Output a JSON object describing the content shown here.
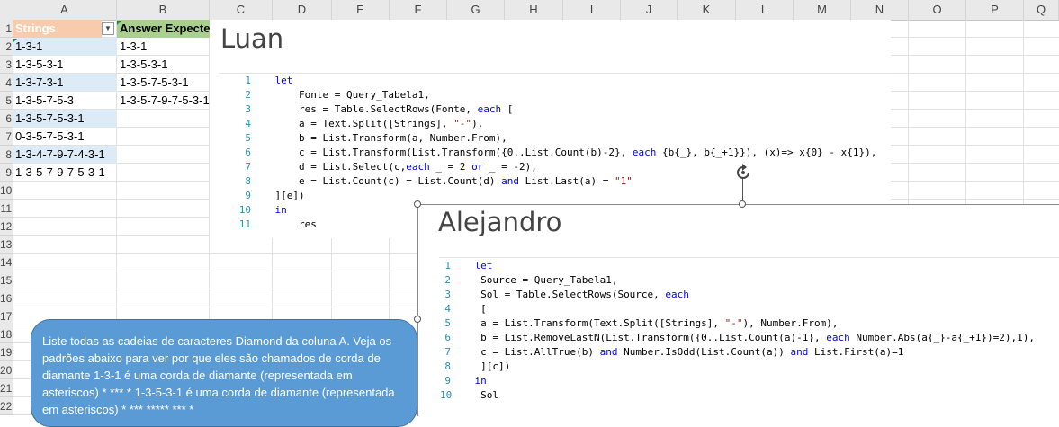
{
  "spreadsheet": {
    "columns": [
      "A",
      "B",
      "C",
      "D",
      "E",
      "F",
      "G",
      "H",
      "I",
      "J",
      "K",
      "L",
      "M",
      "N",
      "O",
      "P",
      "Q"
    ],
    "rows": [
      "1",
      "2",
      "3",
      "4",
      "5",
      "6",
      "7",
      "8",
      "9",
      "10",
      "11",
      "12",
      "13",
      "14",
      "15",
      "16",
      "17",
      "18",
      "19",
      "20",
      "21",
      "22"
    ],
    "header_a": "Strings",
    "header_b": "Answer Expected",
    "strings": [
      "1-3-1",
      "1-3-5-3-1",
      "1-3-7-3-1",
      "1-3-5-7-5-3",
      "1-3-5-7-5-3-1",
      "0-3-5-7-5-3-1",
      "1-3-4-7-9-7-4-3-1",
      "1-3-5-7-9-7-5-3-1"
    ],
    "expected": [
      "1-3-1",
      "1-3-5-3-1",
      "1-3-5-7-5-3-1",
      "1-3-5-7-9-7-5-3-1"
    ],
    "filter_icon": "dropdown-arrow-icon"
  },
  "luan": {
    "title": "Luan",
    "lines": [
      {
        "num": "1",
        "parts": [
          {
            "t": "kw",
            "v": "let"
          }
        ]
      },
      {
        "num": "2",
        "parts": [
          {
            "t": "n",
            "v": "    Fonte = Query_Tabela1,"
          }
        ]
      },
      {
        "num": "3",
        "parts": [
          {
            "t": "n",
            "v": "    res = Table.SelectRows(Fonte, "
          },
          {
            "t": "kw",
            "v": "each"
          },
          {
            "t": "n",
            "v": " ["
          }
        ]
      },
      {
        "num": "4",
        "parts": [
          {
            "t": "n",
            "v": "    a = Text.Split([Strings], "
          },
          {
            "t": "str",
            "v": "\"-\""
          },
          {
            "t": "n",
            "v": "),"
          }
        ]
      },
      {
        "num": "5",
        "parts": [
          {
            "t": "n",
            "v": "    b = List.Transform(a, Number.From),"
          }
        ]
      },
      {
        "num": "6",
        "parts": [
          {
            "t": "n",
            "v": "    c = List.Transform(List.Transform({0..List.Count(b)-2}, "
          },
          {
            "t": "kw",
            "v": "each"
          },
          {
            "t": "n",
            "v": " {b{_}, b{_+1}}), (x)=> x{0} - x{1}),"
          }
        ]
      },
      {
        "num": "7",
        "parts": [
          {
            "t": "n",
            "v": "    d = List.Select(c,"
          },
          {
            "t": "kw",
            "v": "each"
          },
          {
            "t": "n",
            "v": " _ = 2 "
          },
          {
            "t": "kw",
            "v": "or"
          },
          {
            "t": "n",
            "v": " _ = -2),"
          }
        ]
      },
      {
        "num": "8",
        "parts": [
          {
            "t": "n",
            "v": "    e = List.Count(c) = List.Count(d) "
          },
          {
            "t": "kw",
            "v": "and"
          },
          {
            "t": "n",
            "v": " List.Last(a) = "
          },
          {
            "t": "str",
            "v": "\"1\""
          }
        ]
      },
      {
        "num": "9",
        "parts": [
          {
            "t": "n",
            "v": "][e])"
          }
        ]
      },
      {
        "num": "10",
        "parts": [
          {
            "t": "kw",
            "v": "in"
          }
        ]
      },
      {
        "num": "11",
        "parts": [
          {
            "t": "n",
            "v": "    res"
          }
        ]
      }
    ]
  },
  "alejandro": {
    "title": "Alejandro",
    "lines": [
      {
        "num": "1",
        "parts": [
          {
            "t": "kw",
            "v": "let"
          }
        ]
      },
      {
        "num": "2",
        "parts": [
          {
            "t": "n",
            "v": " Source = Query_Tabela1,"
          }
        ]
      },
      {
        "num": "3",
        "parts": [
          {
            "t": "n",
            "v": " Sol = Table.SelectRows(Source, "
          },
          {
            "t": "kw",
            "v": "each"
          }
        ]
      },
      {
        "num": "4",
        "parts": [
          {
            "t": "n",
            "v": " ["
          }
        ]
      },
      {
        "num": "5",
        "parts": [
          {
            "t": "n",
            "v": " a = List.Transform(Text.Split([Strings], "
          },
          {
            "t": "str",
            "v": "\"-\""
          },
          {
            "t": "n",
            "v": "), Number.From),"
          }
        ]
      },
      {
        "num": "6",
        "parts": [
          {
            "t": "n",
            "v": " b = List.RemoveLastN(List.Transform({0..List.Count(a)-1}, "
          },
          {
            "t": "kw",
            "v": "each"
          },
          {
            "t": "n",
            "v": " Number.Abs(a{_}-a{_+1})=2),1),"
          }
        ]
      },
      {
        "num": "7",
        "parts": [
          {
            "t": "n",
            "v": " c = List.AllTrue(b) "
          },
          {
            "t": "kw",
            "v": "and"
          },
          {
            "t": "n",
            "v": " Number.IsOdd(List.Count(a)) "
          },
          {
            "t": "kw",
            "v": "and"
          },
          {
            "t": "n",
            "v": " List.First(a)=1"
          }
        ]
      },
      {
        "num": "8",
        "parts": [
          {
            "t": "n",
            "v": " ][c])"
          }
        ]
      },
      {
        "num": "9",
        "parts": [
          {
            "t": "kw",
            "v": "in"
          }
        ]
      },
      {
        "num": "10",
        "parts": [
          {
            "t": "n",
            "v": " Sol"
          }
        ]
      }
    ]
  },
  "callout": {
    "text": "Liste todas as cadeias de caracteres Diamond da coluna A. Veja os padrões abaixo para ver por que eles são chamados de corda de diamante 1-3-1 é uma corda de diamante (representada em asteriscos)  * ***  * 1-3-5-3-1 é uma corda de diamante (representada em asteriscos)   *  *** *****  ***   *"
  },
  "rotate_icon": "rotate-handle-icon"
}
